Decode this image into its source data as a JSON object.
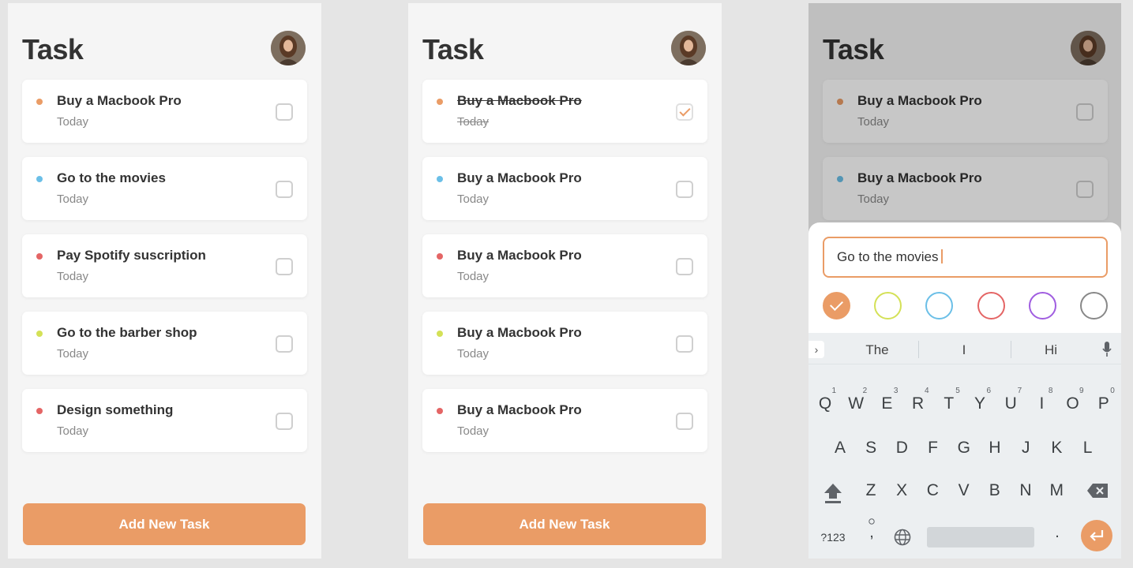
{
  "colors": {
    "accent": "#ea9c66",
    "orange": "#ea9c66",
    "blue": "#6bbfe7",
    "red": "#e46565",
    "lime": "#d4e157",
    "purple": "#a05de0",
    "gray": "#888888"
  },
  "screens": [
    {
      "title": "Task",
      "add_button": "Add New Task",
      "tasks": [
        {
          "title": "Buy a Macbook Pro",
          "date": "Today",
          "dot": "#ea9c66",
          "done": false
        },
        {
          "title": "Go to the movies",
          "date": "Today",
          "dot": "#6bbfe7",
          "done": false
        },
        {
          "title": "Pay Spotify suscription",
          "date": "Today",
          "dot": "#e46565",
          "done": false
        },
        {
          "title": "Go to the barber shop",
          "date": "Today",
          "dot": "#d4e157",
          "done": false
        },
        {
          "title": "Design something",
          "date": "Today",
          "dot": "#e46565",
          "done": false
        }
      ]
    },
    {
      "title": "Task",
      "add_button": "Add New Task",
      "tasks": [
        {
          "title": "Buy a Macbook Pro",
          "date": "Today",
          "dot": "#ea9c66",
          "done": true
        },
        {
          "title": "Buy a Macbook Pro",
          "date": "Today",
          "dot": "#6bbfe7",
          "done": false
        },
        {
          "title": "Buy a Macbook Pro",
          "date": "Today",
          "dot": "#e46565",
          "done": false
        },
        {
          "title": "Buy a Macbook Pro",
          "date": "Today",
          "dot": "#d4e157",
          "done": false
        },
        {
          "title": "Buy a Macbook Pro",
          "date": "Today",
          "dot": "#e46565",
          "done": false
        }
      ]
    },
    {
      "title": "Task",
      "tasks": [
        {
          "title": "Buy a Macbook Pro",
          "date": "Today",
          "dot": "#ea9c66",
          "done": false
        },
        {
          "title": "Buy a Macbook Pro",
          "date": "Today",
          "dot": "#6bbfe7",
          "done": false
        }
      ],
      "new_task": {
        "input_value": "Go to the movies",
        "color_options": [
          {
            "name": "orange",
            "color": "#ea9c66",
            "selected": true
          },
          {
            "name": "lime",
            "color": "#d4e157",
            "selected": false
          },
          {
            "name": "blue",
            "color": "#6bbfe7",
            "selected": false
          },
          {
            "name": "red",
            "color": "#e46565",
            "selected": false
          },
          {
            "name": "purple",
            "color": "#a05de0",
            "selected": false
          },
          {
            "name": "gray",
            "color": "#888888",
            "selected": false
          }
        ]
      },
      "keyboard": {
        "suggestions": [
          "The",
          "I",
          "Hi"
        ],
        "row1": [
          "Q",
          "W",
          "E",
          "R",
          "T",
          "Y",
          "U",
          "I",
          "O",
          "P"
        ],
        "row1_hints": [
          "1",
          "2",
          "3",
          "4",
          "5",
          "6",
          "7",
          "8",
          "9",
          "0"
        ],
        "row2": [
          "A",
          "S",
          "D",
          "F",
          "G",
          "H",
          "J",
          "K",
          "L"
        ],
        "row3": [
          "Z",
          "X",
          "C",
          "V",
          "B",
          "N",
          "M"
        ],
        "symbols_key": "?123",
        "comma_key": ",",
        "period_key": "."
      }
    }
  ]
}
